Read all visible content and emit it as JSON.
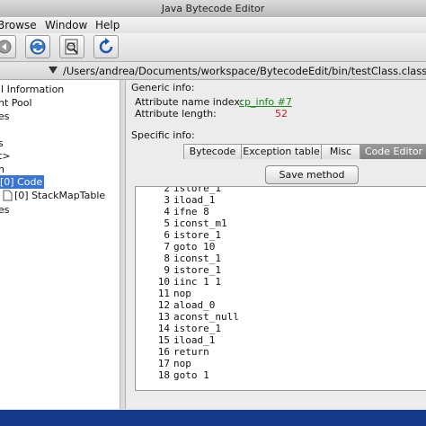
{
  "window": {
    "title": "Java Bytecode Editor"
  },
  "menu": {
    "items": [
      "Browse",
      "Window",
      "Help"
    ]
  },
  "toolbar": {
    "buttons": [
      "back-icon",
      "refresh-icon",
      "inspect-icon",
      "reload-icon"
    ]
  },
  "path": {
    "text": "/Users/andrea/Documents/workspace/BytecodeEdit/bin/testClass.class"
  },
  "tree": {
    "items": [
      {
        "label": "ll Information"
      },
      {
        "label": "nt Pool"
      },
      {
        "label": "es"
      },
      {
        "label": "s"
      },
      {
        "label": "t>"
      },
      {
        "label": "n"
      },
      {
        "label": "[0] Code",
        "selected": true
      },
      {
        "label": "[0] StackMapTable"
      },
      {
        "label": "es"
      }
    ]
  },
  "generic": {
    "title": "Generic info:",
    "name_label": "Attribute name index:",
    "name_link": "cp_info #7",
    "length_label": "Attribute length:",
    "length_value": "52"
  },
  "specific": {
    "title": "Specific info:",
    "tabs": [
      {
        "label": "Bytecode"
      },
      {
        "label": "Exception table"
      },
      {
        "label": "Misc"
      },
      {
        "label": "Code Editor",
        "active": true
      }
    ],
    "save_label": "Save method"
  },
  "code": {
    "lines": [
      {
        "num": "2",
        "text": "istore_1"
      },
      {
        "num": "3",
        "text": "iload_1"
      },
      {
        "num": "4",
        "text": "ifne 8"
      },
      {
        "num": "5",
        "text": "iconst_m1"
      },
      {
        "num": "6",
        "text": "istore_1"
      },
      {
        "num": "7",
        "text": "goto 10"
      },
      {
        "num": "8",
        "text": "iconst_1"
      },
      {
        "num": "9",
        "text": "istore_1"
      },
      {
        "num": "10",
        "text": "iinc 1 1"
      },
      {
        "num": "11",
        "text": "nop"
      },
      {
        "num": "12",
        "text": "aload_0"
      },
      {
        "num": "13",
        "text": "aconst_null"
      },
      {
        "num": "14",
        "text": "istore_1"
      },
      {
        "num": "15",
        "text": "iload_1"
      },
      {
        "num": "16",
        "text": "return"
      },
      {
        "num": "17",
        "text": "nop"
      },
      {
        "num": "18",
        "text": "goto 1"
      }
    ]
  },
  "colors": {
    "selection": "#3875d7",
    "link": "#1a8a1a",
    "value": "#c02020",
    "status_bar": "#163b8a"
  }
}
